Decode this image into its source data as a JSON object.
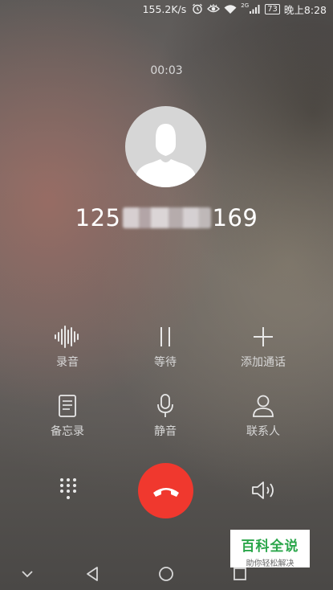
{
  "status_bar": {
    "network_speed": "155.2K/s",
    "network_type": "2G",
    "battery": "73",
    "time": "晚上8:28"
  },
  "call": {
    "duration": "00:03",
    "number_prefix": "125",
    "number_suffix": "169"
  },
  "actions": {
    "record": "录音",
    "hold": "等待",
    "add_call": "添加通话",
    "notes": "备忘录",
    "mute": "静音",
    "contacts": "联系人"
  },
  "watermark": {
    "title": "百科全说",
    "subtitle": "助你轻松解决"
  },
  "colors": {
    "end_call": "#f0382e",
    "watermark_green": "#2aa64a"
  },
  "icons": {
    "record": "waveform-icon",
    "hold": "pause-icon",
    "add_call": "plus-icon",
    "notes": "note-icon",
    "mute": "microphone-icon",
    "contacts": "person-icon",
    "dialpad": "dialpad-icon",
    "end_call": "hangup-icon",
    "speaker": "speaker-icon"
  }
}
